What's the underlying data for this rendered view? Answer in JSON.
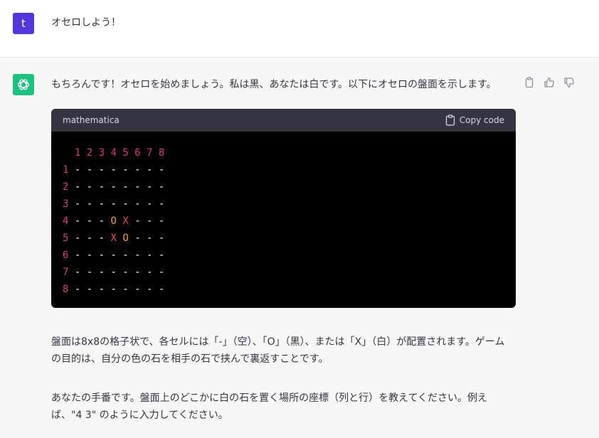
{
  "user": {
    "avatar_letter": "t",
    "message": "オセロしよう！"
  },
  "assistant": {
    "paragraph1": "もちろんです！オセロを始めましょう。私は黒、あなたは白です。以下にオセロの盤面を示します。",
    "code_block": {
      "language": "mathematica",
      "copy_label": "Copy code",
      "header_row": "  1 2 3 4 5 6 7 8",
      "rows": [
        [
          "1",
          "- - - - - - - -"
        ],
        [
          "2",
          "- - - - - - - -"
        ],
        [
          "3",
          "- - - - - - - -"
        ],
        [
          "4",
          "- - - ",
          "O",
          " ",
          "X",
          " - - -"
        ],
        [
          "5",
          "- - - ",
          "X",
          " ",
          "O",
          " - - -"
        ],
        [
          "6",
          "- - - - - - - -"
        ],
        [
          "7",
          "- - - - - - - -"
        ],
        [
          "8",
          "- - - - - - - -"
        ]
      ]
    },
    "paragraph2": "盤面は8x8の格子状で、各セルには「-」（空）、「O」（黒）、または「X」（白）が配置されます。ゲームの目的は、自分の色の石を相手の石で挟んで裏返すことです。",
    "paragraph3": "あなたの手番です。盤面上のどこかに白の石を置く場所の座標（列と行）を教えてください。例えば、\"4 3\" のように入力してください。"
  },
  "colors": {
    "user_avatar": "#5436da",
    "bot_avatar": "#19c37d",
    "code_number": "#df3079",
    "code_o": "#f39c12",
    "code_x": "#ef4444"
  },
  "icons": [
    "openai-logo-icon",
    "clipboard-icon",
    "thumbs-up-icon",
    "thumbs-down-icon"
  ]
}
